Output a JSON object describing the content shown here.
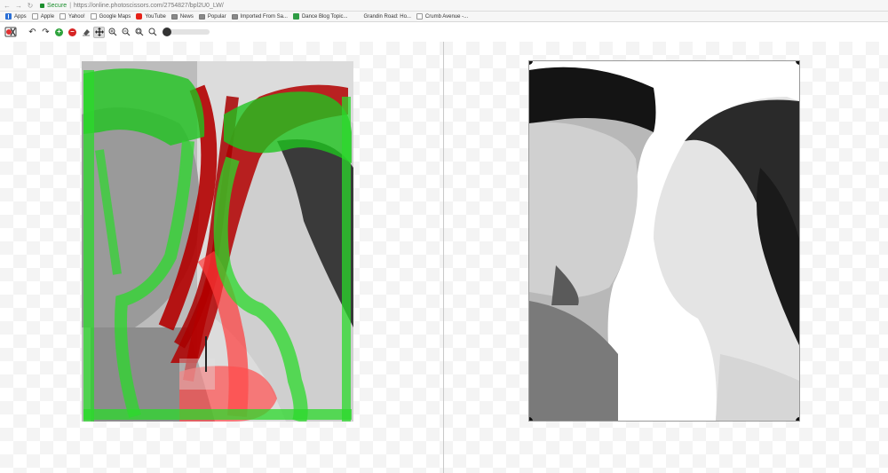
{
  "browser": {
    "secure_label": "Secure",
    "url": "https://online.photoscissors.com/2754827/bpl2U0_LW/",
    "bookmarks": [
      "Apps",
      "Apple",
      "Yahoo!",
      "Google Maps",
      "YouTube",
      "News",
      "Popular",
      "Imported From Sa...",
      "Dance Blog Topic...",
      "Grandin Road: Ho...",
      "Crumb Avenue -..."
    ]
  },
  "toolbar": {
    "tools": [
      "undo-icon",
      "redo-icon",
      "add-foreground-marker-icon",
      "add-background-marker-icon",
      "eraser-icon",
      "pan-icon",
      "zoom-in-icon",
      "zoom-out-icon",
      "zoom-fit-icon",
      "zoom-actual-icon"
    ],
    "brush_size_fraction": 0.0
  },
  "colors": {
    "foreground_marker": "#2fcf2f",
    "background_marker": "#c00000",
    "accent_green": "#2fa33d",
    "accent_red": "#d62424"
  }
}
